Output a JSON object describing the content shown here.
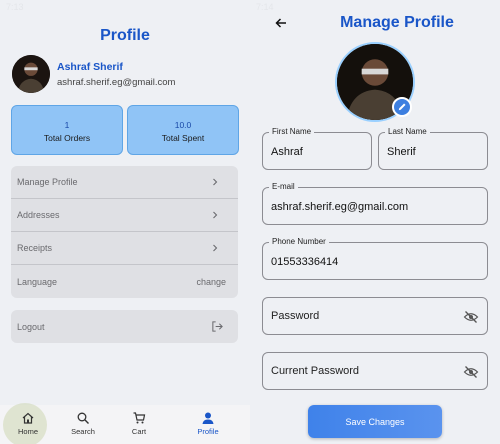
{
  "left_screen": {
    "status_time": "7:13",
    "title": "Profile",
    "user": {
      "name": "Ashraf Sherif",
      "email": "ashraf.sherif.eg@gmail.com"
    },
    "stats": [
      {
        "value": "1",
        "label": "Total Orders"
      },
      {
        "value": "10.0",
        "label": "Total Spent"
      }
    ],
    "menu": [
      {
        "label": "Manage Profile",
        "icon": "chevron-right-icon"
      },
      {
        "label": "Addresses",
        "icon": "chevron-right-icon"
      },
      {
        "label": "Receipts",
        "icon": "chevron-right-icon"
      },
      {
        "label": "Language",
        "right_text": "change"
      }
    ],
    "logout": {
      "label": "Logout",
      "icon": "logout-icon"
    },
    "bottom_nav": [
      {
        "label": "Home",
        "icon": "home-icon",
        "active": false
      },
      {
        "label": "Search",
        "icon": "search-icon",
        "active": false
      },
      {
        "label": "Cart",
        "icon": "cart-icon",
        "active": false
      },
      {
        "label": "Profile",
        "icon": "person-icon",
        "active": true
      }
    ]
  },
  "right_screen": {
    "status_time": "7:14",
    "title": "Manage Profile",
    "fields": {
      "first_name": {
        "label": "First Name",
        "value": "Ashraf"
      },
      "last_name": {
        "label": "Last Name",
        "value": "Sherif"
      },
      "email": {
        "label": "E-mail",
        "value": "ashraf.sherif.eg@gmail.com"
      },
      "phone": {
        "label": "Phone Number",
        "value": "01553336414"
      },
      "password": {
        "placeholder": "Password"
      },
      "current_password": {
        "placeholder": "Current Password"
      }
    },
    "save_label": "Save Changes"
  },
  "colors": {
    "accent": "#1a56c8",
    "card_bg": "#90c4f6",
    "button": "#3f82ea",
    "background": "#eef0f4"
  }
}
